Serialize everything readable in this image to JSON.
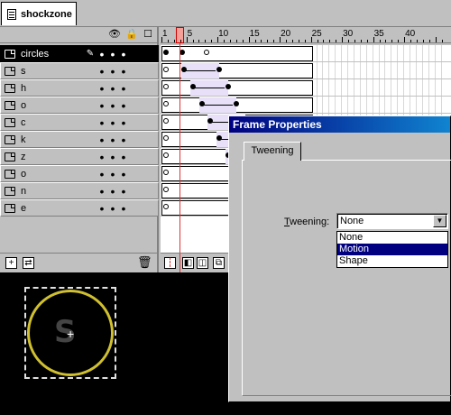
{
  "scene_tab": {
    "label": "shockzone"
  },
  "timeline": {
    "header_icons": [
      "eye-icon",
      "lock-icon",
      "outline-icon"
    ],
    "ruler_labels": [
      "1",
      "5",
      "10",
      "15",
      "20",
      "25",
      "30",
      "35",
      "40"
    ],
    "current_frame": 4,
    "layers": [
      {
        "name": "circles",
        "selected": true
      },
      {
        "name": "s"
      },
      {
        "name": "h"
      },
      {
        "name": "o"
      },
      {
        "name": "c"
      },
      {
        "name": "k"
      },
      {
        "name": "z"
      },
      {
        "name": "o"
      },
      {
        "name": "n"
      },
      {
        "name": "e"
      }
    ],
    "layer_tools": [
      "add-layer-icon",
      "add-guide-icon",
      "trash-icon"
    ],
    "frame_tools": [
      "center-frame-icon",
      "onion-skin-icon",
      "onion-outline-icon",
      "edit-multiple-icon"
    ]
  },
  "dialog": {
    "title": "Frame Properties",
    "tab": "Tweening",
    "label": "Tweening:",
    "selected": "None",
    "options": [
      "None",
      "Motion",
      "Shape"
    ],
    "highlighted": "Motion"
  },
  "colors": {
    "title_bar": "#000080",
    "highlight": "#000080",
    "circle_stroke": "#d0c030",
    "playhead": "#d33"
  }
}
